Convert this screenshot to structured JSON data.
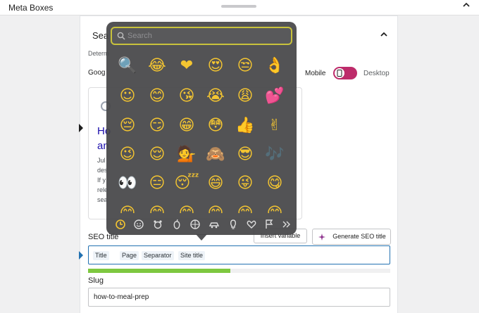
{
  "meta_boxes": {
    "title": "Meta Boxes"
  },
  "section": {
    "title": "Sea",
    "description": "Determ",
    "google_label": "Goog",
    "preview_mode": {
      "mobile": "Mobile",
      "desktop": "Desktop",
      "selected": "Mobile"
    }
  },
  "preview": {
    "title": "Ho\nan",
    "description": "Jul\ndes\nIf y\nrele\nsea"
  },
  "seo_title": {
    "label": "SEO title",
    "insert_variable": "Insert variable",
    "generate": "Generate SEO title",
    "tags": [
      "Title",
      "Page",
      "Separator",
      "Site title"
    ],
    "progress": 0.47
  },
  "slug": {
    "label": "Slug",
    "value": "how-to-meal-prep"
  },
  "emoji_picker": {
    "search_placeholder": "Search",
    "emojis": [
      [
        "🔍",
        "😂",
        "❤",
        "😍",
        "😒",
        "👌"
      ],
      [
        "☺",
        "😊",
        "😘",
        "😭",
        "😩",
        "💕"
      ],
      [
        "😔",
        "😏",
        "😁",
        "😳",
        "👍",
        "✌"
      ],
      [
        "😉",
        "😌",
        "💁",
        "🙈",
        "😎",
        "🎶"
      ],
      [
        "👀",
        "😑",
        "😴",
        "😄",
        "😜",
        "😋"
      ],
      [
        "😊",
        "😊",
        "😊",
        "😊",
        "😊",
        "😊"
      ]
    ],
    "categories": [
      "recent-icon",
      "smileys-icon",
      "animals-icon",
      "food-icon",
      "activity-icon",
      "travel-icon",
      "objects-icon",
      "symbols-icon",
      "flags-icon",
      "more-icon"
    ]
  },
  "colors": {
    "accent": "#bd2b6a",
    "progress": "#7ec840",
    "link": "#1a0dab",
    "focus": "#2271b1"
  }
}
